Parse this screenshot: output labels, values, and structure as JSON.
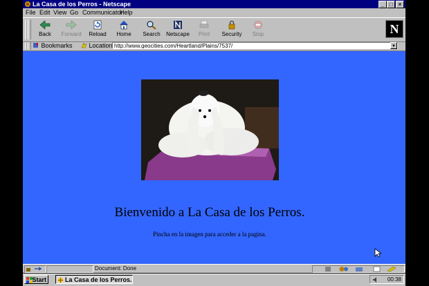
{
  "window": {
    "title": "La Casa de los Perros - Netscape",
    "controls": {
      "minimize": "_",
      "maximize": "□",
      "close": "×"
    }
  },
  "menu": [
    "File",
    "Edit",
    "View",
    "Go",
    "Communicator",
    "Help"
  ],
  "toolbar": {
    "buttons": [
      {
        "label": "Back",
        "icon": "back-arrow-icon",
        "enabled": true
      },
      {
        "label": "Forward",
        "icon": "forward-arrow-icon",
        "enabled": false
      },
      {
        "label": "Reload",
        "icon": "reload-icon",
        "enabled": true
      },
      {
        "label": "Home",
        "icon": "home-icon",
        "enabled": true
      },
      {
        "label": "Search",
        "icon": "search-icon",
        "enabled": true
      },
      {
        "label": "Netscape",
        "icon": "netscape-icon",
        "enabled": true
      },
      {
        "label": "Print",
        "icon": "print-icon",
        "enabled": false
      },
      {
        "label": "Security",
        "icon": "security-icon",
        "enabled": true
      },
      {
        "label": "Stop",
        "icon": "stop-icon",
        "enabled": false
      }
    ],
    "logo": "N"
  },
  "location": {
    "bookmarks_label": "Bookmarks",
    "location_label": "Location:",
    "url": "http://www.geocities.com/Heartland/Plains/7537/"
  },
  "page": {
    "heading": "Bienvenido a La Casa de los Perros.",
    "subtext": "Pincha en la imagen para acceder a la pagina.",
    "background": "#3366ff"
  },
  "status": {
    "text": "Document: Done"
  },
  "taskbar": {
    "start_label": "Start",
    "task_label": "La Casa de los Perros...",
    "clock": "00:38"
  }
}
